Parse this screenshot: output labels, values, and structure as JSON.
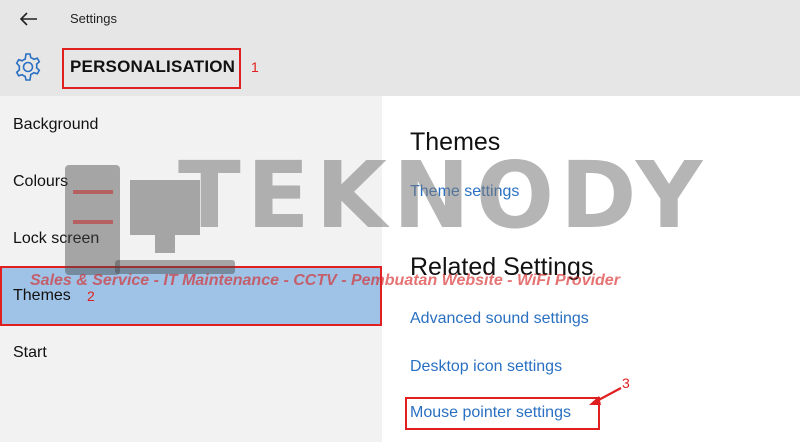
{
  "window": {
    "title": "Settings",
    "back_icon": "arrow-left-icon"
  },
  "header": {
    "icon": "gear-icon",
    "title": "PERSONALISATION"
  },
  "sidebar": {
    "items": [
      {
        "label": "Background",
        "active": false
      },
      {
        "label": "Colours",
        "active": false
      },
      {
        "label": "Lock screen",
        "active": false
      },
      {
        "label": "Themes",
        "active": true
      },
      {
        "label": "Start",
        "active": false
      }
    ]
  },
  "main": {
    "themes_heading": "Themes",
    "theme_settings_link": "Theme settings",
    "related_heading": "Related Settings",
    "related_links": [
      "Advanced sound settings",
      "Desktop icon settings",
      "Mouse pointer settings"
    ]
  },
  "annotations": [
    "1",
    "2",
    "3"
  ],
  "watermark": {
    "logo": "TEKNODY",
    "tagline": "Sales & Service - IT Maintenance - CCTV - Pembuatan Website - WiFi Provider"
  },
  "colors": {
    "accent_link": "#2a70c2",
    "active_item": "#9fc3e7",
    "annotation": "#e02020",
    "titlebar": "#e6e6e6",
    "sidebar": "#f2f2f2"
  }
}
